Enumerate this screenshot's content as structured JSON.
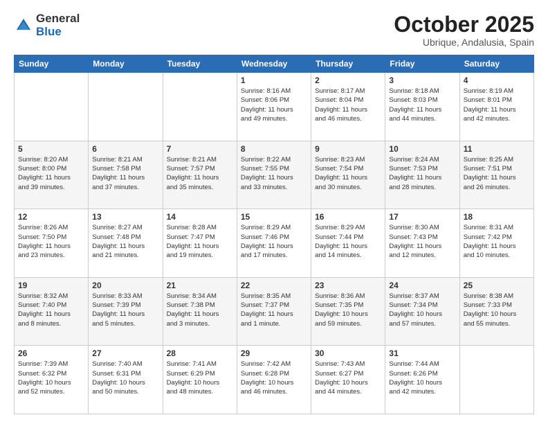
{
  "logo": {
    "general": "General",
    "blue": "Blue"
  },
  "header": {
    "month": "October 2025",
    "location": "Ubrique, Andalusia, Spain"
  },
  "weekdays": [
    "Sunday",
    "Monday",
    "Tuesday",
    "Wednesday",
    "Thursday",
    "Friday",
    "Saturday"
  ],
  "weeks": [
    [
      {
        "day": "",
        "info": ""
      },
      {
        "day": "",
        "info": ""
      },
      {
        "day": "",
        "info": ""
      },
      {
        "day": "1",
        "info": "Sunrise: 8:16 AM\nSunset: 8:06 PM\nDaylight: 11 hours\nand 49 minutes."
      },
      {
        "day": "2",
        "info": "Sunrise: 8:17 AM\nSunset: 8:04 PM\nDaylight: 11 hours\nand 46 minutes."
      },
      {
        "day": "3",
        "info": "Sunrise: 8:18 AM\nSunset: 8:03 PM\nDaylight: 11 hours\nand 44 minutes."
      },
      {
        "day": "4",
        "info": "Sunrise: 8:19 AM\nSunset: 8:01 PM\nDaylight: 11 hours\nand 42 minutes."
      }
    ],
    [
      {
        "day": "5",
        "info": "Sunrise: 8:20 AM\nSunset: 8:00 PM\nDaylight: 11 hours\nand 39 minutes."
      },
      {
        "day": "6",
        "info": "Sunrise: 8:21 AM\nSunset: 7:58 PM\nDaylight: 11 hours\nand 37 minutes."
      },
      {
        "day": "7",
        "info": "Sunrise: 8:21 AM\nSunset: 7:57 PM\nDaylight: 11 hours\nand 35 minutes."
      },
      {
        "day": "8",
        "info": "Sunrise: 8:22 AM\nSunset: 7:55 PM\nDaylight: 11 hours\nand 33 minutes."
      },
      {
        "day": "9",
        "info": "Sunrise: 8:23 AM\nSunset: 7:54 PM\nDaylight: 11 hours\nand 30 minutes."
      },
      {
        "day": "10",
        "info": "Sunrise: 8:24 AM\nSunset: 7:53 PM\nDaylight: 11 hours\nand 28 minutes."
      },
      {
        "day": "11",
        "info": "Sunrise: 8:25 AM\nSunset: 7:51 PM\nDaylight: 11 hours\nand 26 minutes."
      }
    ],
    [
      {
        "day": "12",
        "info": "Sunrise: 8:26 AM\nSunset: 7:50 PM\nDaylight: 11 hours\nand 23 minutes."
      },
      {
        "day": "13",
        "info": "Sunrise: 8:27 AM\nSunset: 7:48 PM\nDaylight: 11 hours\nand 21 minutes."
      },
      {
        "day": "14",
        "info": "Sunrise: 8:28 AM\nSunset: 7:47 PM\nDaylight: 11 hours\nand 19 minutes."
      },
      {
        "day": "15",
        "info": "Sunrise: 8:29 AM\nSunset: 7:46 PM\nDaylight: 11 hours\nand 17 minutes."
      },
      {
        "day": "16",
        "info": "Sunrise: 8:29 AM\nSunset: 7:44 PM\nDaylight: 11 hours\nand 14 minutes."
      },
      {
        "day": "17",
        "info": "Sunrise: 8:30 AM\nSunset: 7:43 PM\nDaylight: 11 hours\nand 12 minutes."
      },
      {
        "day": "18",
        "info": "Sunrise: 8:31 AM\nSunset: 7:42 PM\nDaylight: 11 hours\nand 10 minutes."
      }
    ],
    [
      {
        "day": "19",
        "info": "Sunrise: 8:32 AM\nSunset: 7:40 PM\nDaylight: 11 hours\nand 8 minutes."
      },
      {
        "day": "20",
        "info": "Sunrise: 8:33 AM\nSunset: 7:39 PM\nDaylight: 11 hours\nand 5 minutes."
      },
      {
        "day": "21",
        "info": "Sunrise: 8:34 AM\nSunset: 7:38 PM\nDaylight: 11 hours\nand 3 minutes."
      },
      {
        "day": "22",
        "info": "Sunrise: 8:35 AM\nSunset: 7:37 PM\nDaylight: 11 hours\nand 1 minute."
      },
      {
        "day": "23",
        "info": "Sunrise: 8:36 AM\nSunset: 7:35 PM\nDaylight: 10 hours\nand 59 minutes."
      },
      {
        "day": "24",
        "info": "Sunrise: 8:37 AM\nSunset: 7:34 PM\nDaylight: 10 hours\nand 57 minutes."
      },
      {
        "day": "25",
        "info": "Sunrise: 8:38 AM\nSunset: 7:33 PM\nDaylight: 10 hours\nand 55 minutes."
      }
    ],
    [
      {
        "day": "26",
        "info": "Sunrise: 7:39 AM\nSunset: 6:32 PM\nDaylight: 10 hours\nand 52 minutes."
      },
      {
        "day": "27",
        "info": "Sunrise: 7:40 AM\nSunset: 6:31 PM\nDaylight: 10 hours\nand 50 minutes."
      },
      {
        "day": "28",
        "info": "Sunrise: 7:41 AM\nSunset: 6:29 PM\nDaylight: 10 hours\nand 48 minutes."
      },
      {
        "day": "29",
        "info": "Sunrise: 7:42 AM\nSunset: 6:28 PM\nDaylight: 10 hours\nand 46 minutes."
      },
      {
        "day": "30",
        "info": "Sunrise: 7:43 AM\nSunset: 6:27 PM\nDaylight: 10 hours\nand 44 minutes."
      },
      {
        "day": "31",
        "info": "Sunrise: 7:44 AM\nSunset: 6:26 PM\nDaylight: 10 hours\nand 42 minutes."
      },
      {
        "day": "",
        "info": ""
      }
    ]
  ]
}
